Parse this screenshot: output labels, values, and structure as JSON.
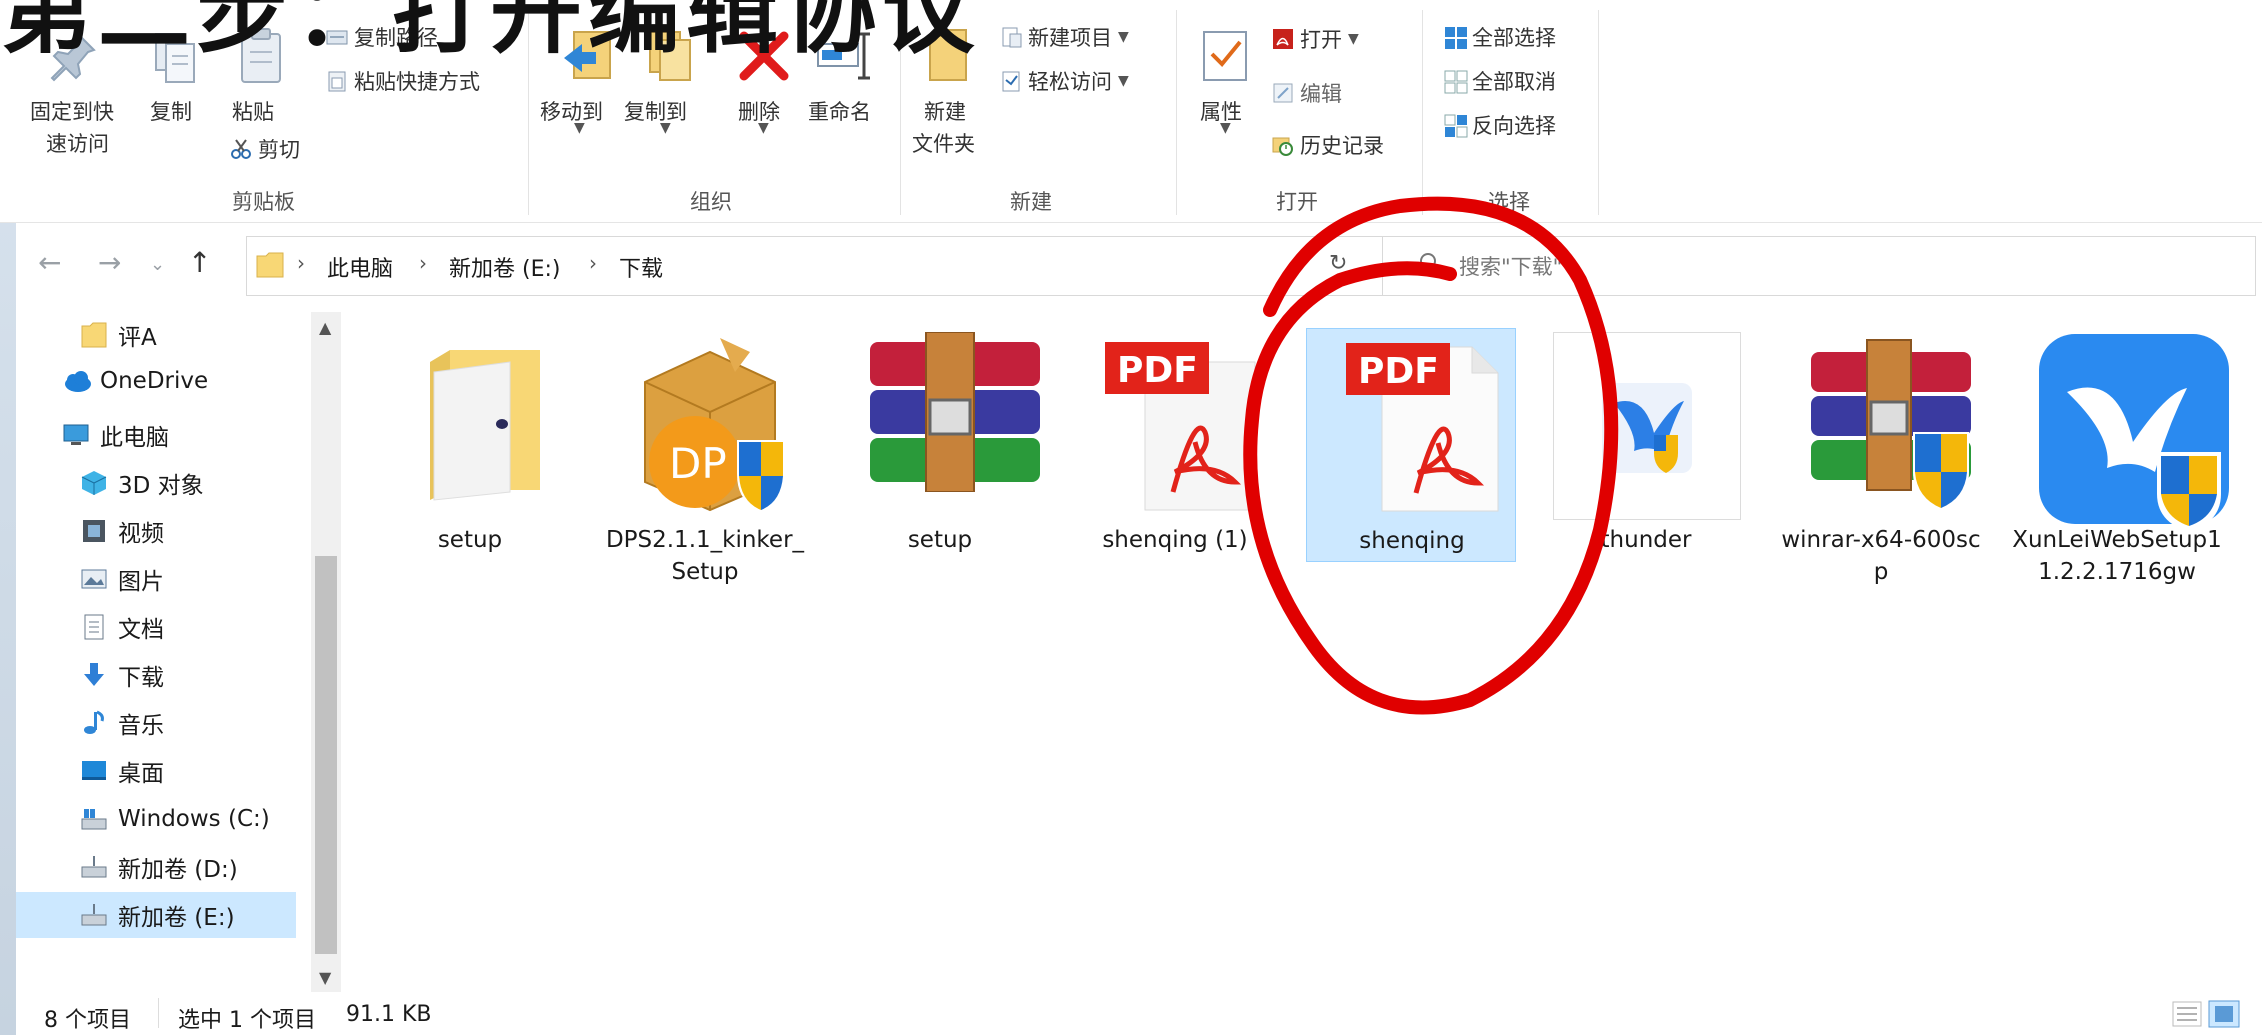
{
  "caption": "第二步：打开编辑协议",
  "ribbon": {
    "clipboard": {
      "pin_label_1": "固定到快",
      "pin_label_2": "速访问",
      "copy_label": "复制",
      "paste_label": "粘贴",
      "copy_path_label": "复制路径",
      "paste_shortcut_label": "粘贴快捷方式",
      "cut_label": "剪切",
      "group_name": "剪贴板"
    },
    "organize": {
      "move_to_label": "移动到",
      "copy_to_label": "复制到",
      "delete_label": "删除",
      "rename_label": "重命名",
      "group_name": "组织"
    },
    "new": {
      "new_folder_label_1": "新建",
      "new_folder_label_2": "文件夹",
      "new_item_label": "新建项目",
      "easy_access_label": "轻松访问",
      "group_name": "新建"
    },
    "open": {
      "properties_label": "属性",
      "open_label": "打开",
      "edit_label": "编辑",
      "history_label": "历史记录",
      "group_name": "打开"
    },
    "select": {
      "select_all_label": "全部选择",
      "select_none_label": "全部取消",
      "invert_label": "反向选择",
      "group_name": "选择"
    }
  },
  "address": {
    "crumbs": [
      "此电脑",
      "新加卷 (E:)",
      "下载"
    ],
    "search_placeholder": "搜索\"下载\""
  },
  "sidebar": {
    "items": [
      {
        "label": "评A"
      },
      {
        "label": "OneDrive"
      },
      {
        "label": "此电脑"
      },
      {
        "label": "3D 对象"
      },
      {
        "label": "视频"
      },
      {
        "label": "图片"
      },
      {
        "label": "文档"
      },
      {
        "label": "下载"
      },
      {
        "label": "音乐"
      },
      {
        "label": "桌面"
      },
      {
        "label": "Windows (C:)"
      },
      {
        "label": "新加卷 (D:)"
      },
      {
        "label": "新加卷 (E:)"
      }
    ]
  },
  "files": [
    {
      "name": "setup",
      "icon": "folder-exe-icon"
    },
    {
      "name": "DPS2.1.1_kinker_Setup",
      "icon": "installer-box-icon"
    },
    {
      "name": "setup",
      "icon": "winrar-icon"
    },
    {
      "name": "shenqing (1)",
      "icon": "pdf-icon"
    },
    {
      "name": "shenqing",
      "icon": "pdf-icon"
    },
    {
      "name": "thunder",
      "icon": "thunder-icon"
    },
    {
      "name": "winrar-x64-600scp",
      "icon": "winrar-shield-icon"
    },
    {
      "name": "XunLeiWebSetup11.2.2.1716gw",
      "icon": "xunlei-icon"
    }
  ],
  "pdf_badge": "PDF",
  "dps_badge": "DP",
  "status": {
    "item_count": "8 个项目",
    "selected": "选中 1 个项目",
    "size": "91.1 KB"
  },
  "colors": {
    "selection_bg": "#cce8ff",
    "pdf_red": "#e2231a",
    "annotation_red": "#e00000",
    "folder_yellow": "#f8d775"
  }
}
